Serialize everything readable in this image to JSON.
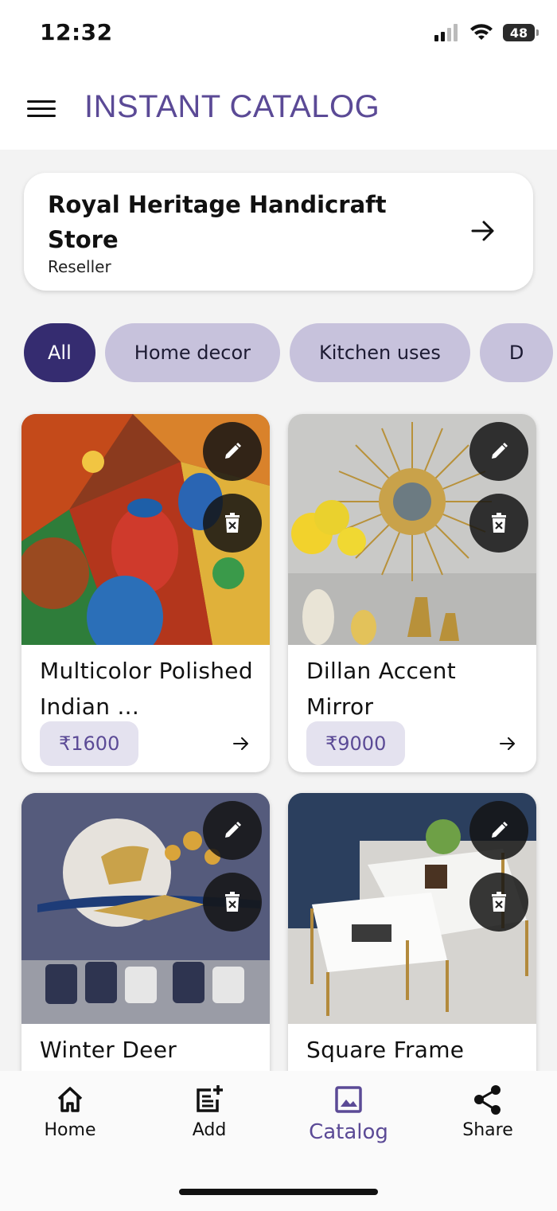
{
  "status_bar": {
    "time": "12:32",
    "battery": "48"
  },
  "app_bar": {
    "title": "INSTANT CATALOG"
  },
  "store": {
    "name": "Royal Heritage Handicraft Store",
    "role": "Reseller"
  },
  "categories": [
    {
      "label": "All",
      "active": true
    },
    {
      "label": "Home decor",
      "active": false
    },
    {
      "label": "Kitchen uses",
      "active": false
    },
    {
      "label": "D",
      "active": false
    }
  ],
  "products": [
    {
      "name": "Multicolor Polished Indian ...",
      "price": "₹1600"
    },
    {
      "name": "Dillan Accent Mirror",
      "price": "₹9000"
    },
    {
      "name": "Winter Deer",
      "price": ""
    },
    {
      "name": "Square Frame",
      "price": ""
    }
  ],
  "bottom_nav": [
    {
      "label": "Home",
      "icon": "home-icon"
    },
    {
      "label": "Add",
      "icon": "add-post-icon"
    },
    {
      "label": "Catalog",
      "icon": "image-icon",
      "active": true
    },
    {
      "label": "Share",
      "icon": "share-icon"
    }
  ],
  "colors": {
    "accent": "#5b4a96",
    "chip_active": "#352c70",
    "chip": "#c7c2dc"
  }
}
